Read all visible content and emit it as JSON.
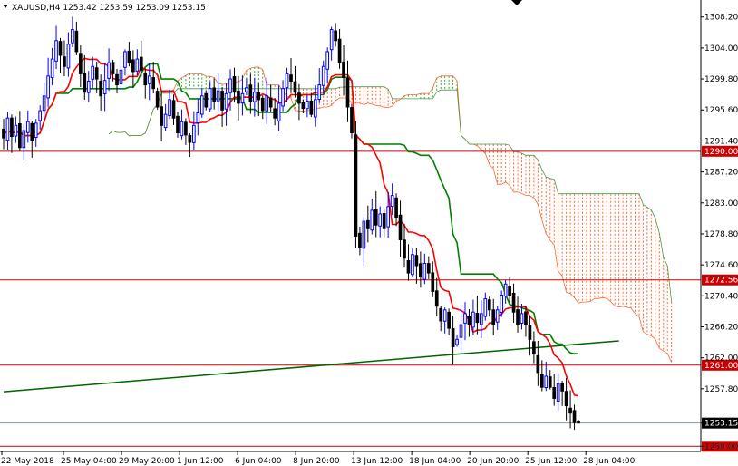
{
  "chart_data": {
    "type": "candlestick",
    "title": "XAUUSD,H4  1253.42 1253.59 1253.09 1253.15",
    "symbol": "XAUUSD,H4",
    "ohlc": {
      "open": 1253.42,
      "high": 1253.59,
      "low": 1253.09,
      "close": 1253.15
    },
    "current_price": 1253.15,
    "ylim": [
      1249.3,
      1310.5
    ],
    "y_ticks": [
      1250.0,
      1253.15,
      1257.8,
      1262.0,
      1266.2,
      1270.4,
      1274.6,
      1278.8,
      1283.0,
      1287.2,
      1291.4,
      1295.6,
      1299.8,
      1304.0,
      1308.2
    ],
    "y_tick_labels": [
      "1250.00",
      "1253.15",
      "1257.80",
      "1262.00",
      "1266.20",
      "1270.40",
      "1274.60",
      "1278.80",
      "1283.00",
      "1287.20",
      "1291.40",
      "1295.60",
      "1299.80",
      "1304.00",
      "1308.20"
    ],
    "x_tick_labels": [
      "22 May 2018",
      "25 May 04:00",
      "29 May 20:00",
      "1 Jun 12:00",
      "6 Jun 04:00",
      "8 Jun 20:00",
      "13 Jun 12:00",
      "18 Jun 04:00",
      "20 Jun 20:00",
      "25 Jun 12:00",
      "28 Jun 04:00"
    ],
    "horizontal_levels": [
      {
        "value": 1290.0,
        "label": "1290.00",
        "color": "#cc0000"
      },
      {
        "value": 1272.56,
        "label": "1272.56",
        "color": "#cc0000"
      },
      {
        "value": 1261.0,
        "label": "1261.00",
        "color": "#cc0000"
      },
      {
        "value": 1250.0,
        "label": "1250.00",
        "color": "#cc0000"
      }
    ],
    "trendline": {
      "from": [
        0,
        1257.4
      ],
      "to": [
        152,
        1264.3
      ],
      "color": "#006400"
    },
    "candle_closes": [
      1291.8,
      1294.5,
      1292.0,
      1293.5,
      1290.5,
      1292.8,
      1294.0,
      1291.5,
      1293.8,
      1295.5,
      1297.5,
      1300.2,
      1302.5,
      1305.0,
      1303.0,
      1301.5,
      1304.5,
      1306.5,
      1303.5,
      1300.5,
      1298.0,
      1299.5,
      1301.5,
      1299.8,
      1297.5,
      1299.6,
      1302.0,
      1300.5,
      1299.0,
      1301.0,
      1303.5,
      1302.0,
      1300.8,
      1302.5,
      1301.0,
      1299.0,
      1300.2,
      1298.5,
      1296.0,
      1293.5,
      1295.0,
      1297.0,
      1294.5,
      1292.5,
      1294.0,
      1292.2,
      1291.2,
      1293.5,
      1295.2,
      1297.5,
      1296.0,
      1298.5,
      1296.8,
      1298.2,
      1295.6,
      1297.8,
      1299.8,
      1298.0,
      1296.5,
      1297.8,
      1298.6,
      1296.8,
      1298.0,
      1297.0,
      1295.5,
      1297.5,
      1296.0,
      1294.5,
      1296.5,
      1298.5,
      1300.5,
      1299.5,
      1298.0,
      1296.5,
      1295.8,
      1296.8,
      1295.0,
      1297.0,
      1299.0,
      1301.5,
      1303.5,
      1306.5,
      1305.0,
      1302.0,
      1300.0,
      1296.0,
      1292.5,
      1278.5,
      1277.0,
      1280.5,
      1279.5,
      1282.0,
      1280.0,
      1281.5,
      1279.5,
      1282.5,
      1284.0,
      1281.0,
      1278.0,
      1275.5,
      1273.5,
      1276.0,
      1274.5,
      1273.0,
      1274.8,
      1273.5,
      1271.0,
      1269.0,
      1267.0,
      1268.5,
      1266.0,
      1263.5,
      1264.5,
      1266.5,
      1268.0,
      1266.5,
      1268.2,
      1266.8,
      1268.0,
      1270.0,
      1268.5,
      1266.5,
      1268.5,
      1270.5,
      1272.0,
      1270.5,
      1268.2,
      1266.5,
      1268.0,
      1266.5,
      1264.5,
      1262.5,
      1260.0,
      1258.0,
      1259.5,
      1258.0,
      1256.5,
      1258.5,
      1257.5,
      1255.5,
      1254.5,
      1253.2,
      1253.15
    ],
    "indicators": {
      "tenkan_sen_color": "#ff0000",
      "kijun_sen_color": "#008000",
      "kumo_bear_color": "#ff6633",
      "kumo_bull_color": "#33aa33",
      "bull_candle_color": "#0000ff",
      "bear_candle_color": "#000000"
    },
    "colors": {
      "background": "#ffffff",
      "axis": "#000000",
      "level_line": "#cc0000",
      "current_price_line": "#8899aa"
    },
    "grid": false
  }
}
